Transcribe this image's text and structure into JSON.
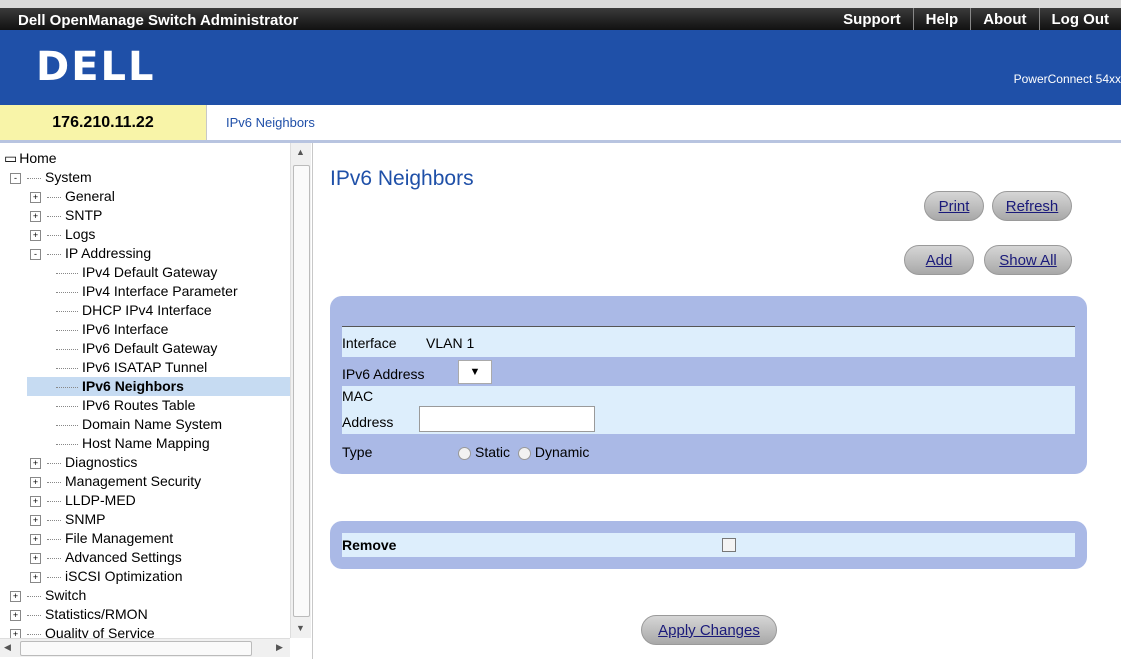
{
  "topbar": {
    "title": "Dell OpenManage Switch Administrator",
    "links": [
      "Support",
      "Help",
      "About",
      "Log Out"
    ]
  },
  "banner": {
    "logo": "DELL",
    "product": "PowerConnect 54xx"
  },
  "ip": "176.210.11.22",
  "breadcrumb": "IPv6 Neighbors",
  "tree": [
    {
      "label": "Home",
      "level": 0,
      "expander": "none"
    },
    {
      "label": "System",
      "level": 1,
      "expander": "-"
    },
    {
      "label": "General",
      "level": 2,
      "expander": "+"
    },
    {
      "label": "SNTP",
      "level": 2,
      "expander": "+"
    },
    {
      "label": "Logs",
      "level": 2,
      "expander": "+"
    },
    {
      "label": "IP Addressing",
      "level": 2,
      "expander": "-"
    },
    {
      "label": "IPv4 Default Gateway",
      "level": 3,
      "expander": "leaf"
    },
    {
      "label": "IPv4 Interface Parameter",
      "level": 3,
      "expander": "leaf"
    },
    {
      "label": "DHCP IPv4 Interface",
      "level": 3,
      "expander": "leaf"
    },
    {
      "label": "IPv6 Interface",
      "level": 3,
      "expander": "leaf"
    },
    {
      "label": "IPv6 Default Gateway",
      "level": 3,
      "expander": "leaf"
    },
    {
      "label": "IPv6 ISATAP Tunnel",
      "level": 3,
      "expander": "leaf"
    },
    {
      "label": "IPv6 Neighbors",
      "level": 3,
      "expander": "leaf",
      "selected": true
    },
    {
      "label": "IPv6 Routes Table",
      "level": 3,
      "expander": "leaf"
    },
    {
      "label": "Domain Name System",
      "level": 3,
      "expander": "leaf"
    },
    {
      "label": "Host Name Mapping",
      "level": 3,
      "expander": "leaf"
    },
    {
      "label": "Diagnostics",
      "level": 2,
      "expander": "+"
    },
    {
      "label": "Management Security",
      "level": 2,
      "expander": "+"
    },
    {
      "label": "LLDP-MED",
      "level": 2,
      "expander": "+"
    },
    {
      "label": "SNMP",
      "level": 2,
      "expander": "+"
    },
    {
      "label": "File Management",
      "level": 2,
      "expander": "+"
    },
    {
      "label": "Advanced Settings",
      "level": 2,
      "expander": "+"
    },
    {
      "label": "iSCSI Optimization",
      "level": 2,
      "expander": "+"
    },
    {
      "label": "Switch",
      "level": 1,
      "expander": "+"
    },
    {
      "label": "Statistics/RMON",
      "level": 1,
      "expander": "+"
    },
    {
      "label": "Quality of Service",
      "level": 1,
      "expander": "+"
    }
  ],
  "page_title": "IPv6 Neighbors",
  "buttons": {
    "print": "Print",
    "refresh": "Refresh",
    "add": "Add",
    "show_all": "Show All",
    "apply": "Apply Changes"
  },
  "form": {
    "interface_label": "Interface",
    "interface_value": "VLAN 1",
    "ipv6_label": "IPv6 Address",
    "mac_label_1": "MAC",
    "mac_label_2": "Address",
    "mac_value": "",
    "type_label": "Type",
    "type_static": "Static",
    "type_dynamic": "Dynamic"
  },
  "remove": {
    "label": "Remove",
    "checked": false
  }
}
